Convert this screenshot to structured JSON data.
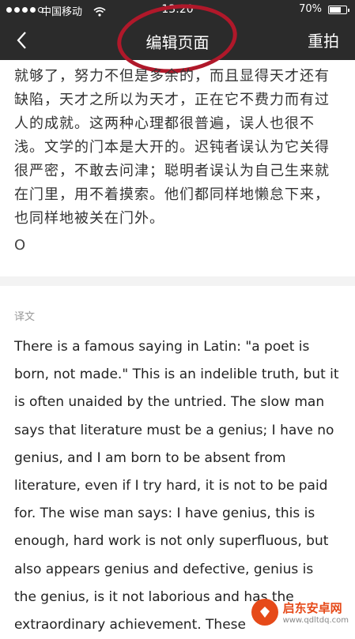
{
  "status_bar": {
    "carrier": "中国移动",
    "time": "13:20",
    "battery_percent": "70%",
    "battery_level": 0.7,
    "signal_bars_filled": 4,
    "signal_bars_total": 5
  },
  "nav": {
    "title": "编辑页面",
    "back_icon": "chevron-left-icon",
    "right_button": "重拍",
    "highlight_color": "#b0182a"
  },
  "chinese_lines": [
    "就够了，努力不但是多余的，而且显得天才还有",
    "缺陷，天才之所以为天才，正在它不费力而有过",
    "人的成就。这两种心理都很普遍，误人也很不",
    "浅。文学的门本是大开的。迟钝者误认为它关得",
    "很严密，不敢去问津；聪明者误认为自己生来就",
    "在门里，用不着摸索。他们都同样地懒怠下来，",
    "也同样地被关在门外。"
  ],
  "ocr_mark": "O",
  "translation_label": "译文",
  "english_lines": [
    "There is a famous saying in Latin: \"a poet is",
    "born, not made.\" This is an indelible truth, but it",
    "is often unaided by the untried. The slow man",
    "says that literature must be a genius; I have no",
    "genius, and I am born to be absent from",
    "literature, even if I try hard, it is not to be paid",
    "for. The wise man says: I have genius, this is",
    "enough, hard work is not only superfluous, but",
    "also appears genius and defective, genius is",
    "the genius, is it not laborious and has the",
    "extraordinary achievement. These"
  ],
  "watermark": {
    "title": "启东安卓网",
    "url": "www.qdltdq.com"
  }
}
